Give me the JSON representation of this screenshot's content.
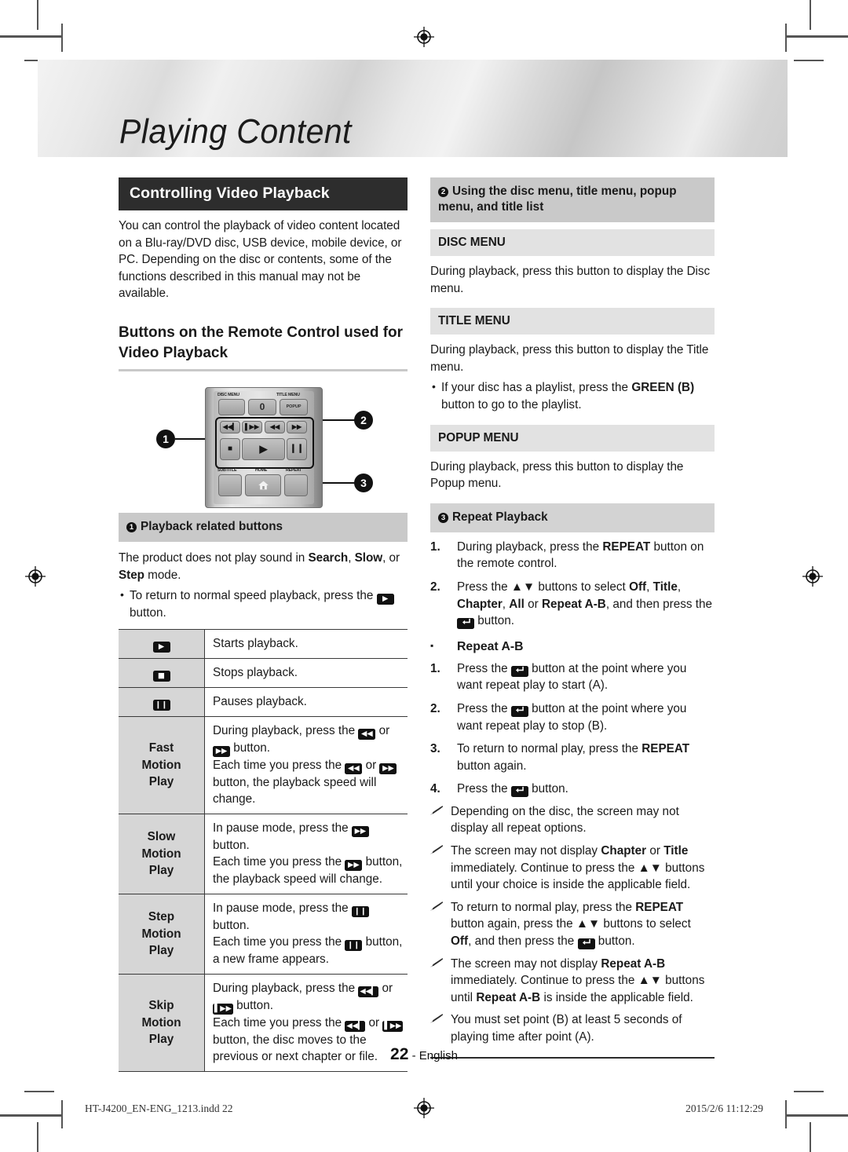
{
  "page": {
    "chapter_title": "Playing Content",
    "page_number": "22",
    "page_language": "English",
    "footer_file": "HT-J4200_EN-ENG_1213.indd   22",
    "footer_timestamp": "2015/2/6   11:12:29"
  },
  "left": {
    "section_title": "Controlling Video Playback",
    "intro": "You can control the playback of video content located on a Blu-ray/DVD disc, USB device, mobile device, or PC. Depending on the disc or contents, some of the functions described in this manual may not be available.",
    "subheading": "Buttons on the Remote Control used for Video Playback",
    "remote": {
      "labels": {
        "disc_menu": "DISC MENU",
        "title_menu": "TITLE MENU",
        "popup": "POPUP",
        "zero": "0",
        "subtitle": "SUBTITLE",
        "home": "HOME",
        "repeat": "REPEAT"
      },
      "callouts": [
        "1",
        "2",
        "3"
      ]
    },
    "group1_header": "Playback related buttons",
    "group1_badge": "1",
    "note_sound": {
      "pre": "The product does not play sound in ",
      "b1": "Search",
      "mid1": ", ",
      "b2": "Slow",
      "mid2": ", or ",
      "b3": "Step",
      "post": " mode."
    },
    "note_bullet": {
      "pre": "To return to normal speed playback, press the ",
      "icon": "play",
      "post": " button."
    },
    "table_rows": [
      {
        "icon": "play",
        "label": "",
        "desc_plain": "Starts playback."
      },
      {
        "icon": "stop",
        "label": "",
        "desc_plain": "Stops playback."
      },
      {
        "icon": "pause",
        "label": "",
        "desc_plain": "Pauses playback."
      },
      {
        "icon": "",
        "label": "Fast\nMotion\nPlay",
        "lines": [
          {
            "pre": "During playback, press the ",
            "i1": "rew",
            "mid": " or ",
            "i2": "ff",
            "post": " button."
          },
          {
            "pre": "Each time you press the ",
            "i1": "rew",
            "mid": " or ",
            "i2": "ff",
            "post": " button, the playback speed will change."
          }
        ]
      },
      {
        "icon": "",
        "label": "Slow\nMotion\nPlay",
        "lines": [
          {
            "pre": "In pause mode, press the ",
            "i1": "ff",
            "mid": "",
            "i2": "",
            "post": " button."
          },
          {
            "pre": "Each time you press the ",
            "i1": "ff",
            "mid": "",
            "i2": "",
            "post": " button, the playback speed will change."
          }
        ]
      },
      {
        "icon": "",
        "label": "Step\nMotion\nPlay",
        "lines": [
          {
            "pre": "In pause mode, press the ",
            "i1": "pause",
            "mid": "",
            "i2": "",
            "post": " button."
          },
          {
            "pre": "Each time you press the ",
            "i1": "pause",
            "mid": "",
            "i2": "",
            "post": " button, a new frame appears."
          }
        ]
      },
      {
        "icon": "",
        "label": "Skip\nMotion\nPlay",
        "lines": [
          {
            "pre": "During playback, press the ",
            "i1": "prev",
            "mid": " or ",
            "i2": "next",
            "post": " button."
          },
          {
            "pre": "Each time you press the ",
            "i1": "prev",
            "mid": " or ",
            "i2": "next",
            "post": " button, the disc moves to the previous or next chapter or file."
          }
        ]
      }
    ]
  },
  "right": {
    "group2_badge": "2",
    "group2_header": "Using the disc menu, title menu, popup menu, and title list",
    "disc_menu_header": "DISC MENU",
    "disc_menu_body": "During playback, press this button to display the Disc menu.",
    "title_menu_header": "TITLE MENU",
    "title_menu_body": "During playback, press this button to display the Title menu.",
    "title_menu_bullet": {
      "pre": "If your disc has a playlist, press the ",
      "b": "GREEN (B)",
      "post": " button to go to the playlist."
    },
    "popup_menu_header": "POPUP MENU",
    "popup_menu_body": "During playback, press this button to display the Popup menu.",
    "group3_badge": "3",
    "group3_header": "Repeat Playback",
    "steps": [
      {
        "n": "1.",
        "parts": [
          {
            "t": "During playback, press the "
          },
          {
            "t": "REPEAT",
            "b": true
          },
          {
            "t": " button on the remote control."
          }
        ]
      },
      {
        "n": "2.",
        "parts": [
          {
            "t": "Press the "
          },
          {
            "t": "▲▼",
            "arrows": true
          },
          {
            "t": " buttons to select "
          },
          {
            "t": "Off",
            "b": true
          },
          {
            "t": ", "
          },
          {
            "t": "Title",
            "b": true
          },
          {
            "t": ", "
          },
          {
            "t": "Chapter",
            "b": true
          },
          {
            "t": ", "
          },
          {
            "t": "All",
            "b": true
          },
          {
            "t": " or "
          },
          {
            "t": "Repeat A-B",
            "b": true
          },
          {
            "t": ", and then press the "
          },
          {
            "icon": "enter"
          },
          {
            "t": " button."
          }
        ]
      }
    ],
    "repeat_ab_title": "Repeat A-B",
    "ab_steps": [
      {
        "n": "1.",
        "parts": [
          {
            "t": "Press the "
          },
          {
            "icon": "enter"
          },
          {
            "t": " button at the point where you want repeat play to start (A)."
          }
        ]
      },
      {
        "n": "2.",
        "parts": [
          {
            "t": "Press the "
          },
          {
            "icon": "enter"
          },
          {
            "t": " button at the point where you want repeat play to stop (B)."
          }
        ]
      },
      {
        "n": "3.",
        "parts": [
          {
            "t": "To return to normal play, press the "
          },
          {
            "t": "REPEAT",
            "b": true
          },
          {
            "t": " button again."
          }
        ]
      },
      {
        "n": "4.",
        "parts": [
          {
            "t": "Press the "
          },
          {
            "icon": "enter"
          },
          {
            "t": " button."
          }
        ]
      }
    ],
    "notes": [
      [
        {
          "t": "Depending on the disc, the screen may not display all repeat options."
        }
      ],
      [
        {
          "t": "The screen may not display "
        },
        {
          "t": "Chapter",
          "b": true
        },
        {
          "t": " or "
        },
        {
          "t": "Title",
          "b": true
        },
        {
          "t": " immediately. Continue to press the "
        },
        {
          "t": "▲▼",
          "arrows": true
        },
        {
          "t": " buttons until your choice is inside the applicable field."
        }
      ],
      [
        {
          "t": "To return to normal play, press the "
        },
        {
          "t": "REPEAT",
          "b": true
        },
        {
          "t": " button again, press the "
        },
        {
          "t": "▲▼",
          "arrows": true
        },
        {
          "t": " buttons to select "
        },
        {
          "t": "Off",
          "b": true
        },
        {
          "t": ", and then press the "
        },
        {
          "icon": "enter"
        },
        {
          "t": " button."
        }
      ],
      [
        {
          "t": "The screen may not display "
        },
        {
          "t": "Repeat A-B",
          "b": true
        },
        {
          "t": " immediately. Continue to press the "
        },
        {
          "t": "▲▼",
          "arrows": true
        },
        {
          "t": " buttons until "
        },
        {
          "t": "Repeat A-B",
          "b": true
        },
        {
          "t": " is inside the applicable field."
        }
      ],
      [
        {
          "t": "You must set point (B) at least 5 seconds of playing time after point (A)."
        }
      ]
    ]
  },
  "icons": {
    "play": "▶",
    "stop": "■",
    "pause": "❙❙",
    "rew": "◀◀",
    "ff": "▶▶",
    "prev": "◀◀❙",
    "next": "❙▶▶",
    "enter": "↵",
    "home": "home-icon",
    "note": "pencil-icon"
  }
}
